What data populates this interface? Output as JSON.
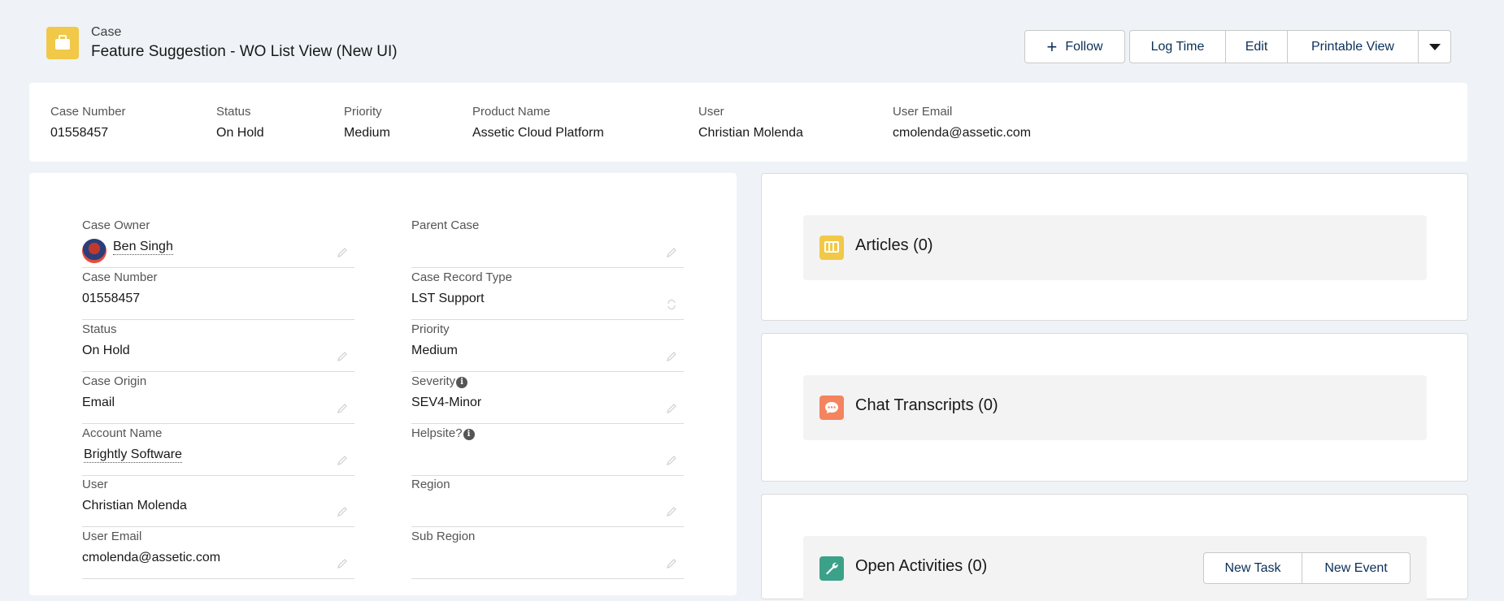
{
  "header": {
    "object_label": "Case",
    "record_title": "Feature Suggestion - WO List View (New UI)",
    "icon": "briefcase-icon",
    "buttons": {
      "follow": "Follow",
      "log_time": "Log Time",
      "edit": "Edit",
      "printable_view": "Printable View"
    }
  },
  "highlights": [
    {
      "label": "Case Number",
      "value": "01558457"
    },
    {
      "label": "Status",
      "value": "On Hold"
    },
    {
      "label": "Priority",
      "value": "Medium"
    },
    {
      "label": "Product Name",
      "value": "Assetic Cloud Platform"
    },
    {
      "label": "User",
      "value": "Christian Molenda"
    },
    {
      "label": "User Email",
      "value": "cmolenda@assetic.com"
    }
  ],
  "details": {
    "left": [
      {
        "label": "Case Owner",
        "value": "Ben Singh"
      },
      {
        "label": "Case Number",
        "value": "01558457"
      },
      {
        "label": "Status",
        "value": "On Hold"
      },
      {
        "label": "Case Origin",
        "value": "Email"
      },
      {
        "label": "Account Name",
        "value": "Brightly Software"
      },
      {
        "label": "User",
        "value": "Christian Molenda"
      },
      {
        "label": "User Email",
        "value": "cmolenda@assetic.com"
      }
    ],
    "right": [
      {
        "label": "Parent Case",
        "value": ""
      },
      {
        "label": "Case Record Type",
        "value": "LST Support"
      },
      {
        "label": "Priority",
        "value": "Medium"
      },
      {
        "label": "Severity",
        "value": "SEV4-Minor"
      },
      {
        "label": "Helpsite?",
        "value": ""
      },
      {
        "label": "Region",
        "value": ""
      },
      {
        "label": "Sub Region",
        "value": ""
      }
    ]
  },
  "related": {
    "articles": {
      "title": "Articles (0)",
      "icon": "articles-icon",
      "color": "#f1c848"
    },
    "chats": {
      "title": "Chat Transcripts (0)",
      "icon": "chat-icon",
      "color": "#f4845f"
    },
    "activities": {
      "title": "Open Activities (0)",
      "icon": "wrench-icon",
      "color": "#3ba189",
      "new_task": "New Task",
      "new_event": "New Event"
    }
  }
}
